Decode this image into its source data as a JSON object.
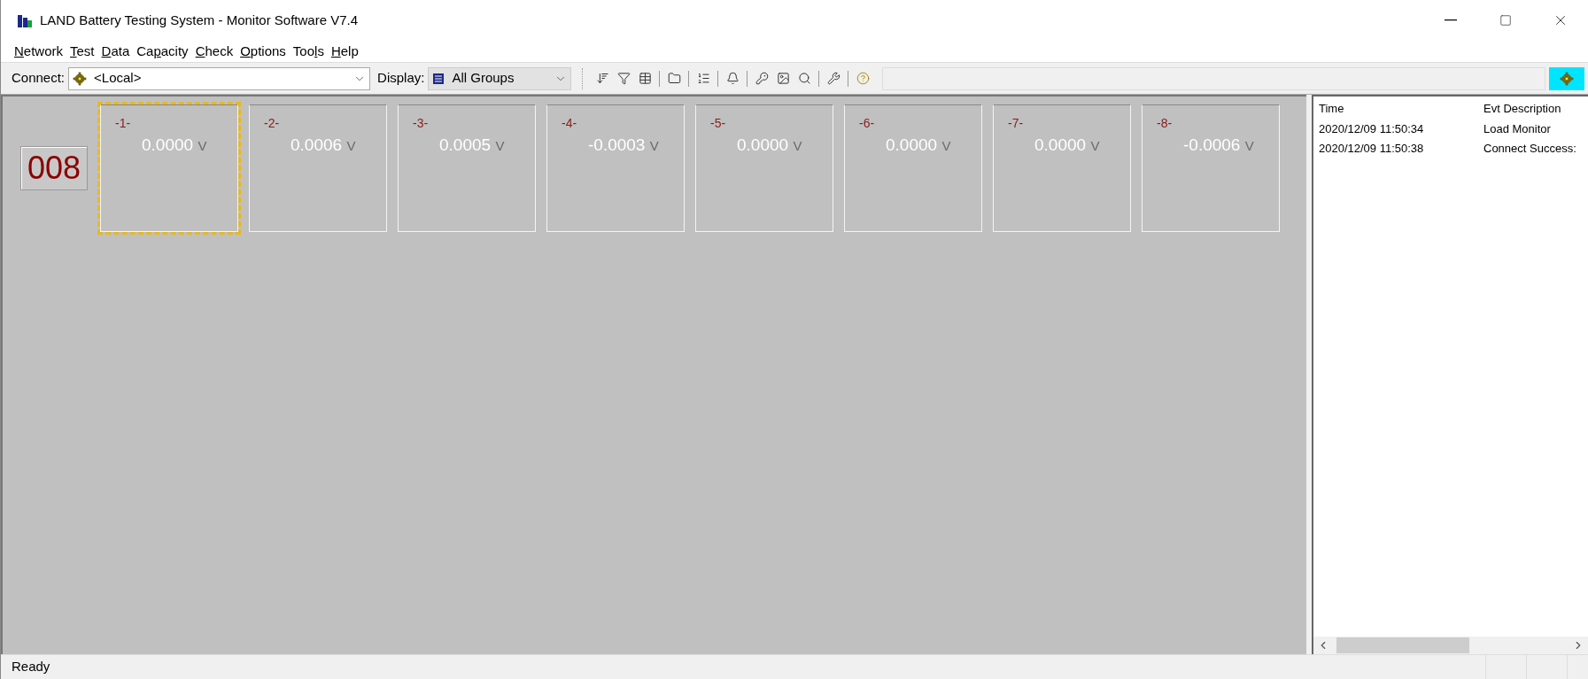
{
  "window": {
    "title": "LAND Battery Testing System - Monitor Software V7.4"
  },
  "menu": [
    {
      "key": "N",
      "after": "etwork"
    },
    {
      "key": "T",
      "after": "est"
    },
    {
      "key": "D",
      "after": "ata"
    },
    {
      "before": "Ca",
      "key": "p",
      "after": "acity"
    },
    {
      "key": "C",
      "after": "heck"
    },
    {
      "key": "O",
      "after": "ptions"
    },
    {
      "before": "Too",
      "key": "l",
      "after": "s"
    },
    {
      "key": "H",
      "after": "elp"
    }
  ],
  "toolbar": {
    "connect_label": "Connect:",
    "connect_value": "<Local>",
    "display_label": "Display:",
    "display_value": "All Groups"
  },
  "box_number": "008",
  "channels": [
    {
      "label": "-1-",
      "value": "0.0000",
      "unit": "V",
      "selected": true
    },
    {
      "label": "-2-",
      "value": "0.0006",
      "unit": "V",
      "selected": false
    },
    {
      "label": "-3-",
      "value": "0.0005",
      "unit": "V",
      "selected": false
    },
    {
      "label": "-4-",
      "value": "-0.0003",
      "unit": "V",
      "selected": false
    },
    {
      "label": "-5-",
      "value": "0.0000",
      "unit": "V",
      "selected": false
    },
    {
      "label": "-6-",
      "value": "0.0000",
      "unit": "V",
      "selected": false
    },
    {
      "label": "-7-",
      "value": "0.0000",
      "unit": "V",
      "selected": false
    },
    {
      "label": "-8-",
      "value": "-0.0006",
      "unit": "V",
      "selected": false
    }
  ],
  "events": {
    "columns": [
      "Time",
      "Evt Description"
    ],
    "rows": [
      [
        "2020/12/09 11:50:34",
        "Load Monitor"
      ],
      [
        "2020/12/09 11:50:38",
        "Connect Success:"
      ]
    ]
  },
  "status_bar": {
    "text": "Ready"
  }
}
